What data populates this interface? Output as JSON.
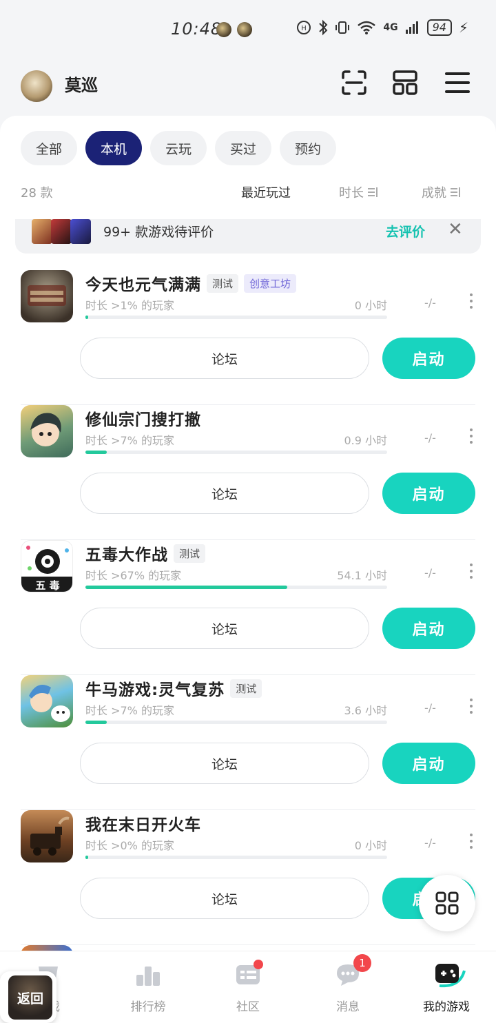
{
  "status_bar": {
    "time": "10:48",
    "network": "4G",
    "wifi_badge": "6",
    "battery": "94"
  },
  "header": {
    "user_name": "莫巡",
    "icons": [
      "scan-icon",
      "layout-grid-icon",
      "menu-icon"
    ]
  },
  "tabs": [
    {
      "label": "全部",
      "active": false
    },
    {
      "label": "本机",
      "active": true
    },
    {
      "label": "云玩",
      "active": false
    },
    {
      "label": "买过",
      "active": false
    },
    {
      "label": "预约",
      "active": false
    }
  ],
  "sort_row": {
    "count": "28 款",
    "recent": "最近玩过",
    "duration": "时长",
    "achievement": "成就"
  },
  "banner": {
    "text": "99+ 款游戏待评价",
    "link": "去评价",
    "close": "✕"
  },
  "games": [
    {
      "title": "今天也元气满满",
      "tags": [
        {
          "text": "测试",
          "style": "gray"
        },
        {
          "text": "创意工坊",
          "style": "purple"
        }
      ],
      "sub": "时长 >1% 的玩家",
      "hours": "0 小时",
      "achievement": "-/-",
      "progress": 0.01,
      "forum": "论坛",
      "launch": "启动",
      "colors": [
        "#8e8673",
        "#3b3128"
      ]
    },
    {
      "title": "修仙宗门搜打撤",
      "tags": [],
      "sub": "时长 >7% 的玩家",
      "hours": "0.9 小时",
      "achievement": "-/-",
      "progress": 0.07,
      "forum": "论坛",
      "launch": "启动",
      "colors": [
        "#f3cf7a",
        "#3f6b5a"
      ]
    },
    {
      "title": "五毒大作战",
      "tags": [
        {
          "text": "测试",
          "style": "gray"
        }
      ],
      "sub": "时长 >67% 的玩家",
      "hours": "54.1 小时",
      "achievement": "-/-",
      "progress": 0.67,
      "forum": "论坛",
      "launch": "启动",
      "colors": [
        "#ffffff",
        "#1b1b1b"
      ]
    },
    {
      "title": "牛马游戏:灵气复苏",
      "tags": [
        {
          "text": "测试",
          "style": "gray"
        }
      ],
      "sub": "时长 >7% 的玩家",
      "hours": "3.6 小时",
      "achievement": "-/-",
      "progress": 0.07,
      "forum": "论坛",
      "launch": "启动",
      "colors": [
        "#6fc2e5",
        "#f0c98a"
      ]
    },
    {
      "title": "我在末日开火车",
      "tags": [],
      "sub": "时长 >0% 的玩家",
      "hours": "0 小时",
      "achievement": "-/-",
      "progress": 0.01,
      "forum": "论坛",
      "launch": "启动",
      "colors": [
        "#c58b57",
        "#3a2718"
      ]
    }
  ],
  "bottom_nav": [
    {
      "label": "游戏",
      "icon": "game-icon",
      "active": false
    },
    {
      "label": "排行榜",
      "icon": "ranking-icon",
      "active": false
    },
    {
      "label": "社区",
      "icon": "community-icon",
      "active": false,
      "dot": true
    },
    {
      "label": "消息",
      "icon": "message-icon",
      "active": false,
      "badge": "1"
    },
    {
      "label": "我的游戏",
      "icon": "my-games-icon",
      "active": true
    }
  ],
  "back_button": "返回",
  "colors": {
    "accent": "#18d4bf",
    "tab_active": "#1b2276",
    "progress": "#23c99c",
    "tag_purple": "#7269d8"
  }
}
